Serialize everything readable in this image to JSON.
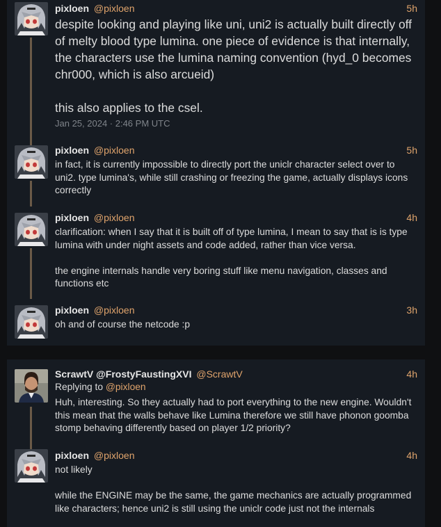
{
  "colors": {
    "background": "#0f1012",
    "card": "#161b22",
    "accent": "#e0a46c",
    "text": "#dcdcdc",
    "muted": "#7f848a",
    "thread_line": "#6b5a48"
  },
  "thread1": {
    "tweets": [
      {
        "fullname": "pixloen",
        "username": "@pixloen",
        "date": "5h",
        "content": "despite looking and playing like uni, uni2 is actually built directly off of melty blood type lumina. one piece of evidence is that internally, the characters use the lumina naming convention (hyd_0 becomes chr000, which is also arcueid)\n\nthis also applies to the csel.",
        "published": "Jan 25, 2024 · 2:46 PM UTC",
        "avatar": "anime-avatar-icon"
      },
      {
        "fullname": "pixloen",
        "username": "@pixloen",
        "date": "5h",
        "content": "in fact, it is currently impossible to directly port the uniclr character select over to uni2. type lumina's, while still crashing or freezing the game, actually displays icons correctly",
        "avatar": "anime-avatar-icon"
      },
      {
        "fullname": "pixloen",
        "username": "@pixloen",
        "date": "4h",
        "content": "clarification: when I say that it is built off of type lumina, I mean to say that is is type lumina with under night assets and code added, rather than vice versa.\n\nthe engine internals handle very boring stuff like menu navigation, classes and functions etc",
        "avatar": "anime-avatar-icon"
      },
      {
        "fullname": "pixloen",
        "username": "@pixloen",
        "date": "3h",
        "content": "oh and of course the netcode :p",
        "avatar": "anime-avatar-icon"
      }
    ]
  },
  "thread2": {
    "tweets": [
      {
        "fullname": "ScrawtV @FrostyFaustingXVI",
        "username": "@ScrawtV",
        "date": "4h",
        "replying_label": "Replying to",
        "replying_to": "@pixloen",
        "content": "Huh, interesting. So they actually had to port everything to the new engine. Wouldn't this mean that the walls behave like Lumina therefore we still have phonon goomba stomp behaving differently based on player 1/2 priority?",
        "avatar": "person-avatar-icon"
      },
      {
        "fullname": "pixloen",
        "username": "@pixloen",
        "date": "4h",
        "content": "not likely\n\nwhile the ENGINE may be the same, the game mechanics are actually programmed like characters; hence uni2 is still using the uniclr code just not the internals",
        "avatar": "anime-avatar-icon"
      }
    ]
  }
}
